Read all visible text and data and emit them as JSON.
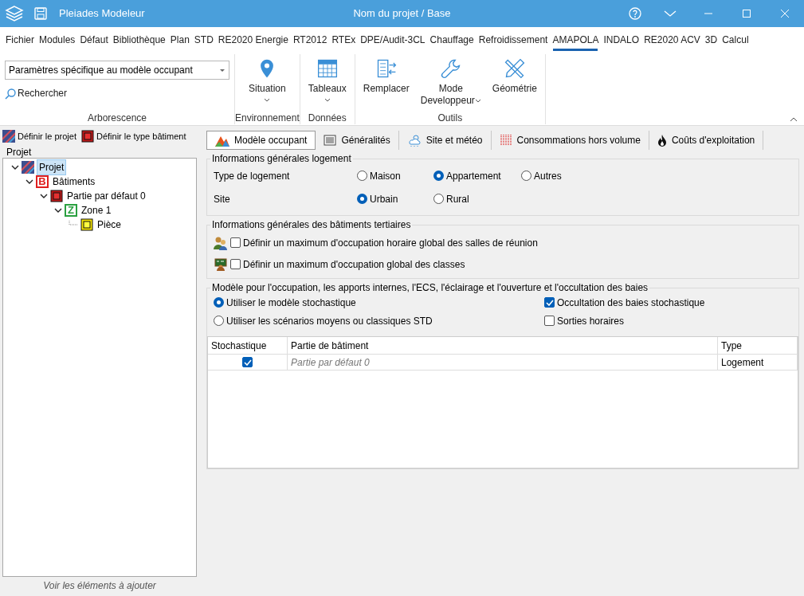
{
  "window": {
    "app": "Pleiades Modeleur",
    "title": "Nom du projet / Base"
  },
  "menu": [
    {
      "label": "Fichier",
      "selected": false
    },
    {
      "label": "Modules",
      "selected": false
    },
    {
      "label": "Défaut",
      "selected": false
    },
    {
      "label": "Bibliothèque",
      "selected": false
    },
    {
      "label": "Plan",
      "selected": false
    },
    {
      "label": "STD",
      "selected": false
    },
    {
      "label": "RE2020 Energie",
      "selected": false
    },
    {
      "label": "RT2012",
      "selected": false
    },
    {
      "label": "RTEx",
      "selected": false
    },
    {
      "label": "DPE/Audit-3CL",
      "selected": false
    },
    {
      "label": "Chauffage",
      "selected": false
    },
    {
      "label": "Refroidissement",
      "selected": false
    },
    {
      "label": "AMAPOLA",
      "selected": true
    },
    {
      "label": "INDALO",
      "selected": false
    },
    {
      "label": "RE2020 ACV",
      "selected": false
    },
    {
      "label": "3D",
      "selected": false
    },
    {
      "label": "Calcul",
      "selected": false
    }
  ],
  "ribbon": {
    "combo": "Paramètres spécifique au modèle occupant",
    "search": "Rechercher",
    "groups": [
      {
        "label": "Arborescence",
        "kind": "tree-tools"
      },
      {
        "label": "Environnement",
        "kind": "buttons",
        "buttons": [
          {
            "label": "Situation",
            "kind": "pin",
            "dropdown": true
          }
        ]
      },
      {
        "label": "Données",
        "kind": "buttons",
        "buttons": [
          {
            "label": "Tableaux",
            "kind": "table",
            "dropdown": true
          }
        ]
      },
      {
        "label": "Outils",
        "kind": "buttons",
        "buttons": [
          {
            "label": "Remplacer",
            "kind": "replace",
            "dropdown": false
          },
          {
            "label": "Mode Developpeur",
            "kind": "wrench",
            "dropdown": true
          },
          {
            "label": "Géométrie",
            "kind": "ruler",
            "dropdown": false
          }
        ]
      }
    ]
  },
  "left": {
    "tools": [
      {
        "label": "Définir le projet",
        "kind": "project"
      },
      {
        "label": "Définir le type bâtiment",
        "kind": "part"
      }
    ],
    "tree_title": "Projet",
    "tree": [
      {
        "label": "Projet",
        "kind": "project",
        "selected": true,
        "expanded": true,
        "children": [
          {
            "label": "Bâtiments",
            "kind": "building",
            "letter": "B",
            "selected": false,
            "expanded": true,
            "children": [
              {
                "label": "Partie par défaut 0",
                "kind": "part",
                "selected": false,
                "expanded": true,
                "children": [
                  {
                    "label": "Zone 1",
                    "kind": "zone",
                    "letter": "Z",
                    "selected": false,
                    "expanded": true,
                    "children": [
                      {
                        "label": "Pièce",
                        "kind": "room",
                        "selected": false
                      }
                    ]
                  }
                ]
              }
            ]
          }
        ]
      }
    ],
    "footer": "Voir les éléments à ajouter"
  },
  "tabs": [
    {
      "label": "Modèle occupant",
      "kind": "mountain",
      "selected": true
    },
    {
      "label": "Généralités",
      "kind": "lines",
      "selected": false
    },
    {
      "label": "Site et météo",
      "kind": "cloud",
      "selected": false
    },
    {
      "label": "Consommations hors volume",
      "kind": "hatch",
      "selected": false
    },
    {
      "label": "Coûts d'exploitation",
      "kind": "flame",
      "selected": false
    }
  ],
  "logement": {
    "title": "Informations générales logement",
    "rows": [
      {
        "label": "Type de logement",
        "options": [
          {
            "label": "Maison",
            "selected": false
          },
          {
            "label": "Appartement",
            "selected": true
          },
          {
            "label": "Autres",
            "selected": false
          }
        ]
      },
      {
        "label": "Site",
        "options": [
          {
            "label": "Urbain",
            "selected": true
          },
          {
            "label": "Rural",
            "selected": false
          }
        ]
      }
    ]
  },
  "tertiaire": {
    "title": "Informations générales des bâtiments tertiaires",
    "items": [
      {
        "label": "Définir un maximum d'occupation horaire global des salles de réunion",
        "kind": "people",
        "checked": false
      },
      {
        "label": "Définir un maximum d'occupation global des classes",
        "kind": "board",
        "checked": false
      }
    ]
  },
  "model": {
    "title": "Modèle pour l'occupation, les apports internes, l'ECS, l'éclairage et l'ouverture et l'occultation des baies",
    "radios": [
      {
        "label": "Utiliser le modèle stochastique",
        "selected": true
      },
      {
        "label": "Utiliser les scénarios moyens ou classiques STD",
        "selected": false
      }
    ],
    "checks": [
      {
        "label": "Occultation des baies stochastique",
        "checked": true
      },
      {
        "label": "Sorties horaires",
        "checked": false
      }
    ],
    "table": {
      "columns": [
        "Stochastique",
        "Partie de bâtiment",
        "Type"
      ],
      "rows": [
        {
          "stochastique": true,
          "part": "Partie par défaut 0",
          "type": "Logement"
        }
      ]
    }
  }
}
